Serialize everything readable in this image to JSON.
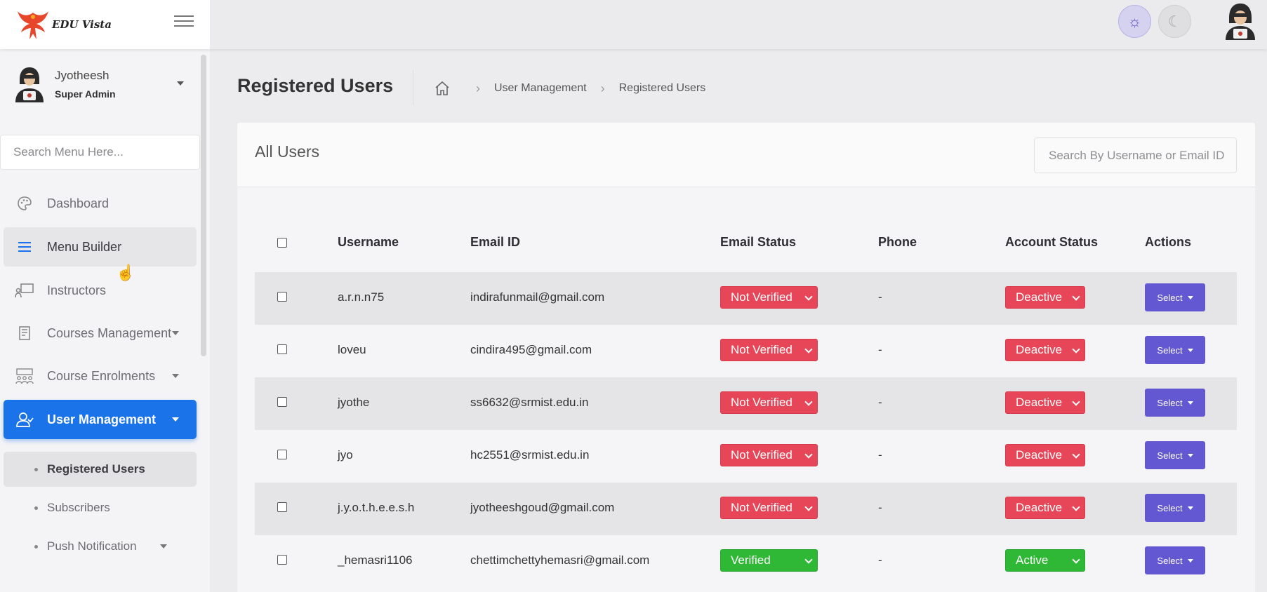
{
  "brand": {
    "name": "EDU Vista",
    "icon": "phoenix-logo"
  },
  "colors": {
    "accent": "#1a73e8",
    "danger": "#e64657",
    "success": "#2eb836",
    "action": "#6358d1"
  },
  "header": {
    "theme_light_icon": "sun-icon",
    "theme_dark_icon": "moon-icon"
  },
  "profile": {
    "name": "Jyotheesh",
    "role": "Super Admin"
  },
  "sidebar": {
    "search_placeholder": "Search Menu Here...",
    "items": [
      {
        "label": "Dashboard",
        "icon": "palette-icon"
      },
      {
        "label": "Menu Builder",
        "icon": "list-icon"
      },
      {
        "label": "Instructors",
        "icon": "presentation-icon"
      },
      {
        "label": "Courses Management",
        "icon": "book-icon"
      },
      {
        "label": "Course Enrolments",
        "icon": "group-icon"
      },
      {
        "label": "User Management",
        "icon": "users-icon"
      }
    ],
    "sub_items": [
      {
        "label": "Registered Users"
      },
      {
        "label": "Subscribers"
      },
      {
        "label": "Push Notification"
      }
    ]
  },
  "page": {
    "title": "Registered Users",
    "breadcrumb": [
      "User Management",
      "Registered Users"
    ]
  },
  "card": {
    "title": "All Users",
    "search_placeholder": "Search By Username or Email ID"
  },
  "table": {
    "columns": [
      "Username",
      "Email ID",
      "Email Status",
      "Phone",
      "Account Status",
      "Actions"
    ],
    "rows": [
      {
        "username": "a.r.n.n75",
        "email": "indirafunmail@gmail.com",
        "email_status": "Not Verified",
        "phone": "-",
        "account_status": "Deactive",
        "action": "Select"
      },
      {
        "username": "loveu",
        "email": "cindira495@gmail.com",
        "email_status": "Not Verified",
        "phone": "-",
        "account_status": "Deactive",
        "action": "Select"
      },
      {
        "username": "jyothe",
        "email": "ss6632@srmist.edu.in",
        "email_status": "Not Verified",
        "phone": "-",
        "account_status": "Deactive",
        "action": "Select"
      },
      {
        "username": "jyo",
        "email": "hc2551@srmist.edu.in",
        "email_status": "Not Verified",
        "phone": "-",
        "account_status": "Deactive",
        "action": "Select"
      },
      {
        "username": "j.y.o.t.h.e.e.s.h",
        "email": "jyotheeshgoud@gmail.com",
        "email_status": "Not Verified",
        "phone": "-",
        "account_status": "Deactive",
        "action": "Select"
      },
      {
        "username": "_hemasri1106",
        "email": "chettimchettyhemasri@gmail.com",
        "email_status": "Verified",
        "phone": "-",
        "account_status": "Active",
        "action": "Select"
      }
    ]
  }
}
